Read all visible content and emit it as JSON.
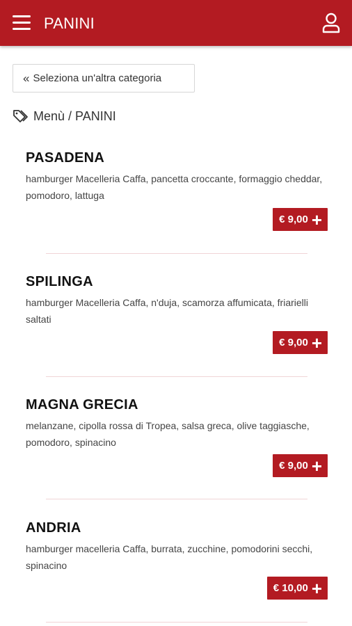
{
  "appbar": {
    "title": "PANINI",
    "menu_icon": "hamburger-menu-icon",
    "user_icon": "user-icon",
    "color": "#b31b22"
  },
  "back_button": {
    "label": "Seleziona un'altra categoria",
    "icon": "double-chevron-left-icon"
  },
  "breadcrumb": {
    "icon": "tag-icon",
    "text": "Menù / PANINI"
  },
  "items": [
    {
      "name": "PASADENA",
      "description": "hamburger Macelleria Caffa, pancetta croccante, formaggio cheddar, pomodoro, lattuga",
      "price": "€ 9,00"
    },
    {
      "name": "SPILINGA",
      "description": "hamburger Macelleria Caffa, n'duja, scamorza affumicata, friarielli saltati",
      "price": "€ 9,00"
    },
    {
      "name": "MAGNA GRECIA",
      "description": "melanzane, cipolla rossa di Tropea, salsa greca, olive taggiasche, pomodoro, spinacino",
      "price": "€ 9,00"
    },
    {
      "name": "ANDRIA",
      "description": "hamburger macelleria Caffa, burrata, zucchine, pomodorini secchi, spinacino",
      "price": "€ 10,00"
    }
  ]
}
